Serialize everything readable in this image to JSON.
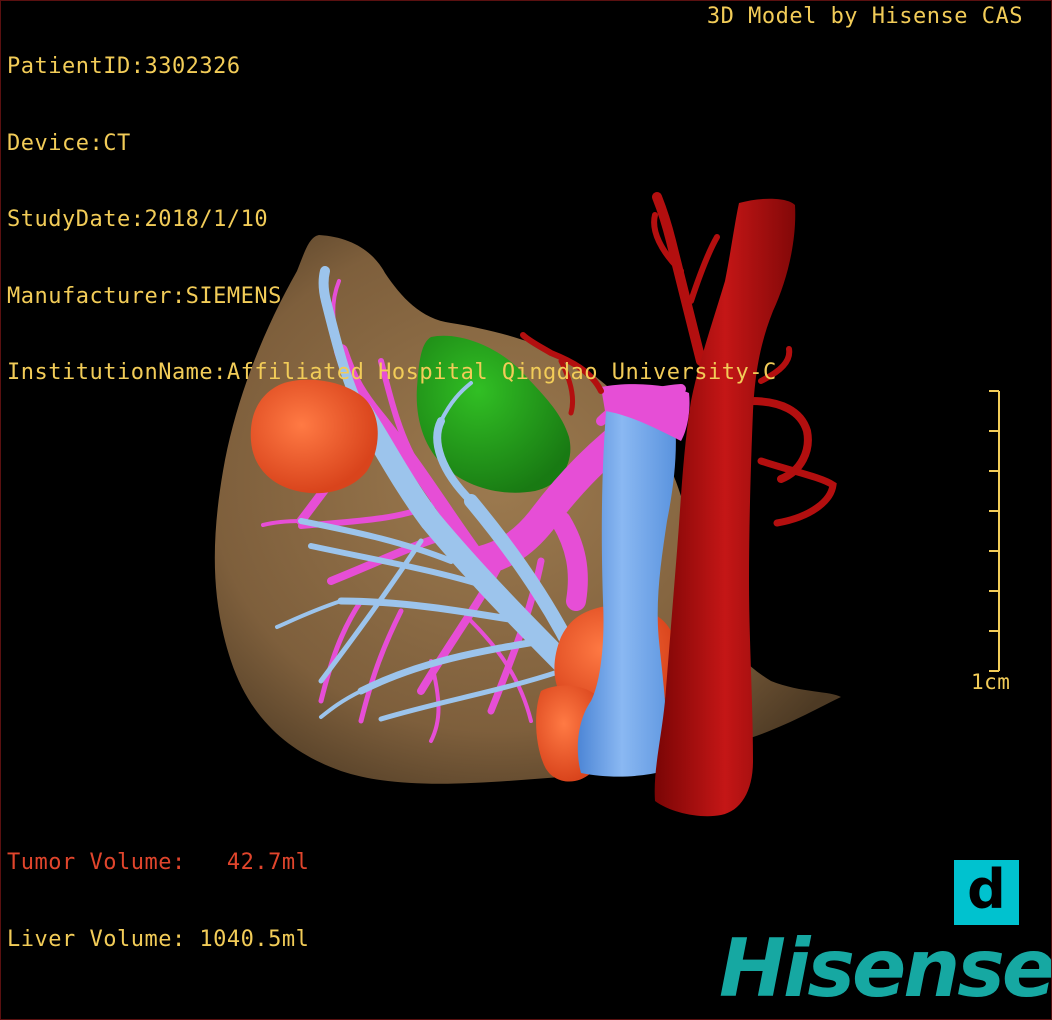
{
  "viewer": {
    "patient_line": "PatientID:3302326",
    "device_line": "Device:CT",
    "study_date_line": "StudyDate:2018/1/10",
    "manufacturer_line": "Manufacturer:SIEMENS",
    "institution_line": "InstitutionName:Affiliated Hospital Qingdao University-C",
    "model_credit": "3D Model by Hisense CAS"
  },
  "volumes": {
    "tumor_line": "Tumor Volume:   42.7ml",
    "liver_line": "Liver Volume: 1040.5ml"
  },
  "scale_bar": {
    "label": "1cm",
    "ticks": 8,
    "color": "#f2cc58"
  },
  "view_button": {
    "label": "d",
    "color": "#00c2cf"
  },
  "logo": {
    "text": "Hisense",
    "color": "#16a8a2"
  },
  "colors": {
    "liver": "#8c6a43",
    "tumor": "#ff5a2a",
    "gallbladder": "#22a31c",
    "portal_vein": "#e64ed6",
    "hepatic_vein": "#9cc4ec",
    "ivc": "#6fa8ef",
    "artery": "#b30f0f",
    "overlay_text": "#f2cc58"
  }
}
